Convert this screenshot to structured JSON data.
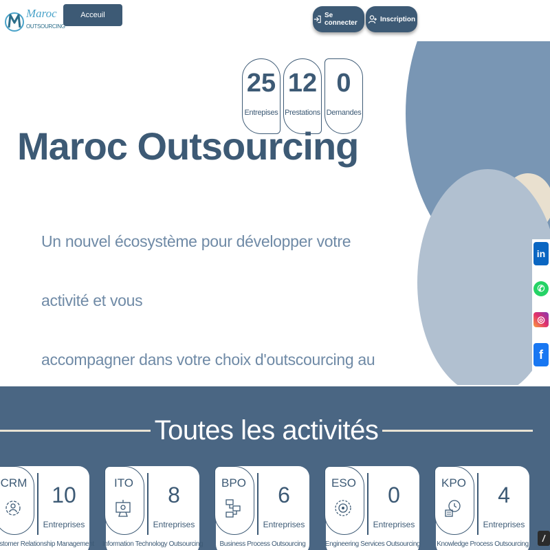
{
  "header": {
    "logo": {
      "name": "Maroc",
      "sub": "OUTSOURCING"
    },
    "nav": {
      "home": "Acceuil",
      "login": "Se connecter",
      "signup": "Inscription"
    }
  },
  "hero": {
    "title": "Maroc Outsourcing",
    "text_line1": "Un nouvel écosystème pour développer votre activité et vous",
    "text_line2": "accompagner dans votre choix d'outscourcing au Maroc."
  },
  "stats": [
    {
      "value": "25",
      "label": "Entrepises"
    },
    {
      "value": "12",
      "label": "Prestations"
    },
    {
      "value": "0",
      "label": "Demandes"
    }
  ],
  "social": [
    {
      "icon": "linkedin-icon",
      "glyph": "in"
    },
    {
      "icon": "whatsapp-icon",
      "glyph": "✆"
    },
    {
      "icon": "instagram-icon",
      "glyph": "◎"
    },
    {
      "icon": "facebook-icon",
      "glyph": "f"
    }
  ],
  "activities": {
    "title": "Toutes les activités",
    "items": [
      {
        "code": "CRM",
        "count": "10",
        "label": "Entreprises",
        "name": "Customer Relationship Management"
      },
      {
        "code": "ITO",
        "count": "8",
        "label": "Entreprises",
        "name": "Information Technology Outsourcing"
      },
      {
        "code": "BPO",
        "count": "6",
        "label": "Entreprises",
        "name": "Business Process Outsourcing"
      },
      {
        "code": "ESO",
        "count": "0",
        "label": "Entreprises",
        "name": "Engineering Services Outsourcing"
      },
      {
        "code": "KPO",
        "count": "4",
        "label": "Entreprises",
        "name": "Knowledge Process Outsourcing"
      }
    ]
  },
  "colors": {
    "primary": "#3d5a75",
    "section_bg": "#4a6683",
    "circle_dark": "#7996b4",
    "circle_light": "#b1c0d0",
    "accent_beige": "#e9e0cf"
  }
}
